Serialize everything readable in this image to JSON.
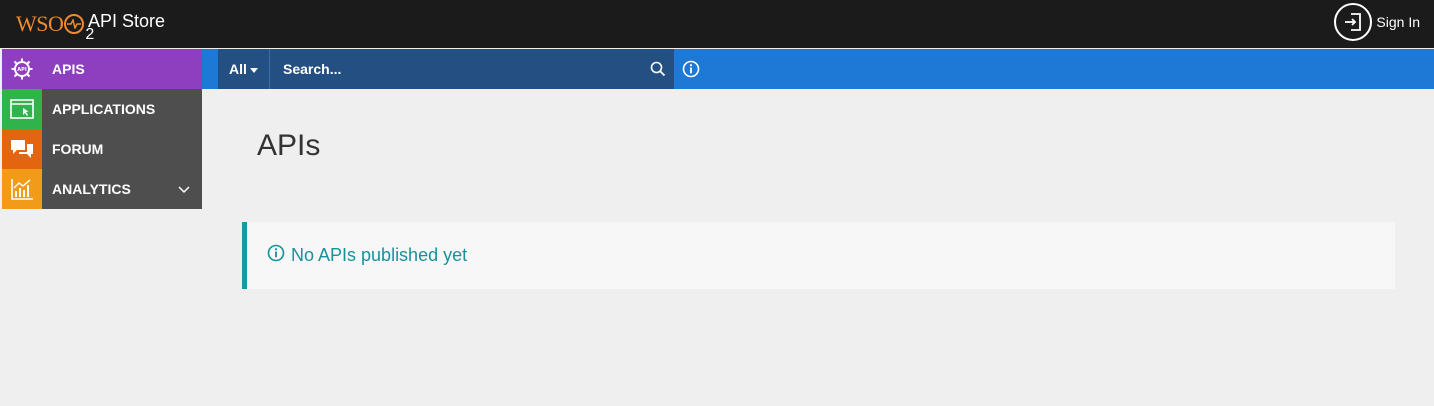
{
  "header": {
    "logo_text": "WSO",
    "logo_sub": "2",
    "title": "API Store",
    "signin_label": "Sign In"
  },
  "sidebar": {
    "items": [
      {
        "label": "APIS",
        "icon": "apis-gear-icon",
        "color": "#8e3fbf",
        "active": true
      },
      {
        "label": "APPLICATIONS",
        "icon": "applications-window-icon",
        "color": "#2fb34a"
      },
      {
        "label": "FORUM",
        "icon": "forum-chat-icon",
        "color": "#e4650f"
      },
      {
        "label": "ANALYTICS",
        "icon": "analytics-chart-icon",
        "color": "#f29b18",
        "has_submenu": true
      }
    ]
  },
  "search": {
    "filter_label": "All",
    "placeholder": "Search..."
  },
  "main": {
    "title": "APIs",
    "alert_text": "No APIs published yet"
  },
  "colors": {
    "topbar": "#1b1b1b",
    "searchbar": "#1e78d6",
    "search_box": "#234f82",
    "alert_accent": "#139aa4",
    "logo": "#f08a2c"
  }
}
